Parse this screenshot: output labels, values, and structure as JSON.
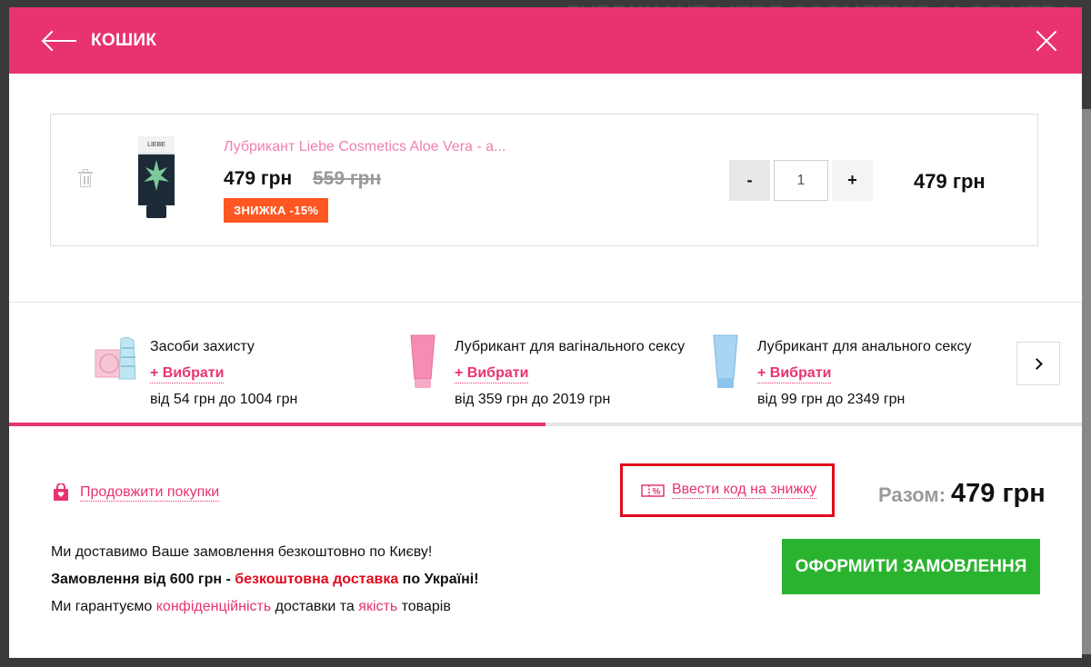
{
  "header": {
    "title": "КОШИК"
  },
  "cart": {
    "items": [
      {
        "title": "Лубрикант Liebe Cosmetics Aloe Vera - а...",
        "price": "479 грн",
        "old_price": "559 грн",
        "discount": "ЗНИЖКА -15%",
        "quantity": "1",
        "minus": "-",
        "plus": "+",
        "total": "479 грн",
        "image_brand": "LIEBE"
      }
    ]
  },
  "upsell": {
    "choose_label": "+ Вибрати",
    "items": [
      {
        "title": "Засоби захисту",
        "range": "від 54 грн до 1004 грн",
        "icon": "condom-icon",
        "color": "#f4a9c0"
      },
      {
        "title": "Лубрикант для вагінального сексу",
        "range": "від 359 грн до 2019 грн",
        "icon": "pink-tube-icon",
        "color": "#f58cb4"
      },
      {
        "title": "Лубрикант для анального сексу",
        "range": "від 99 грн до 2349 грн",
        "icon": "blue-tube-icon",
        "color": "#8cc4ec"
      }
    ],
    "progress": 0.5
  },
  "footer": {
    "continue_label": "Продовжити покупки",
    "promo_label": "Ввести код на знижку",
    "total_label": "Разом:",
    "total_value": "479 грн",
    "delivery_line1": "Ми доставимо Ваше замовлення безкоштовно по Києву!",
    "delivery_line2_part1": "Замовлення від 600 грн - ",
    "delivery_line2_part2": "безкоштовна доставка",
    "delivery_line2_part3": " по Україні!",
    "delivery_line3_part1": "Ми гарантуємо ",
    "delivery_line3_link1": "конфіденційність",
    "delivery_line3_part2": " доставки та ",
    "delivery_line3_link2": "якість",
    "delivery_line3_part3": " товарів",
    "checkout_label": "ОФОРМИТИ ЗАМОВЛЕННЯ"
  },
  "colors": {
    "brand_pink": "#e8336e",
    "checkout_green": "#2ab32f",
    "discount_orange": "#ff5722",
    "highlight_red": "#e00b1c"
  }
}
